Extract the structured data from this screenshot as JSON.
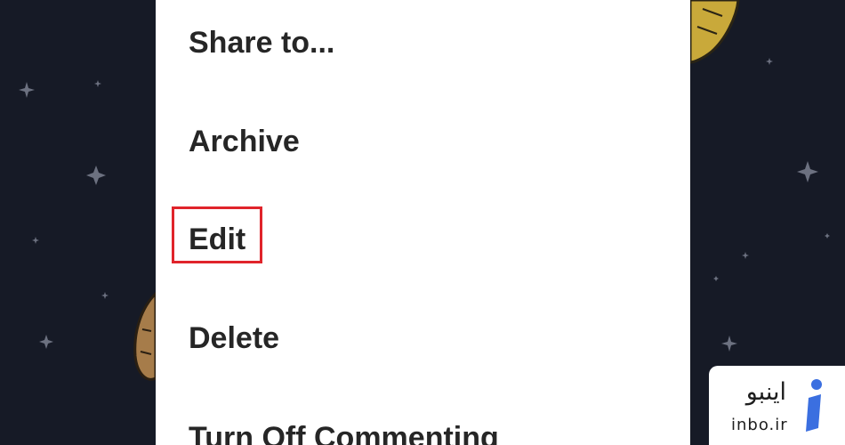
{
  "menu": {
    "items": [
      {
        "label": "Share to..."
      },
      {
        "label": "Archive"
      },
      {
        "label": "Edit"
      },
      {
        "label": "Delete"
      },
      {
        "label": "Turn Off Commenting"
      }
    ],
    "highlighted_item": "Edit"
  },
  "watermark": {
    "name_fa": "اینبو",
    "domain": "inbo.ir"
  },
  "colors": {
    "background": "#161a26",
    "sheet": "#ffffff",
    "menu_text": "#262626",
    "highlight_border": "#e0242b",
    "logo_blue": "#3b6fe0"
  }
}
